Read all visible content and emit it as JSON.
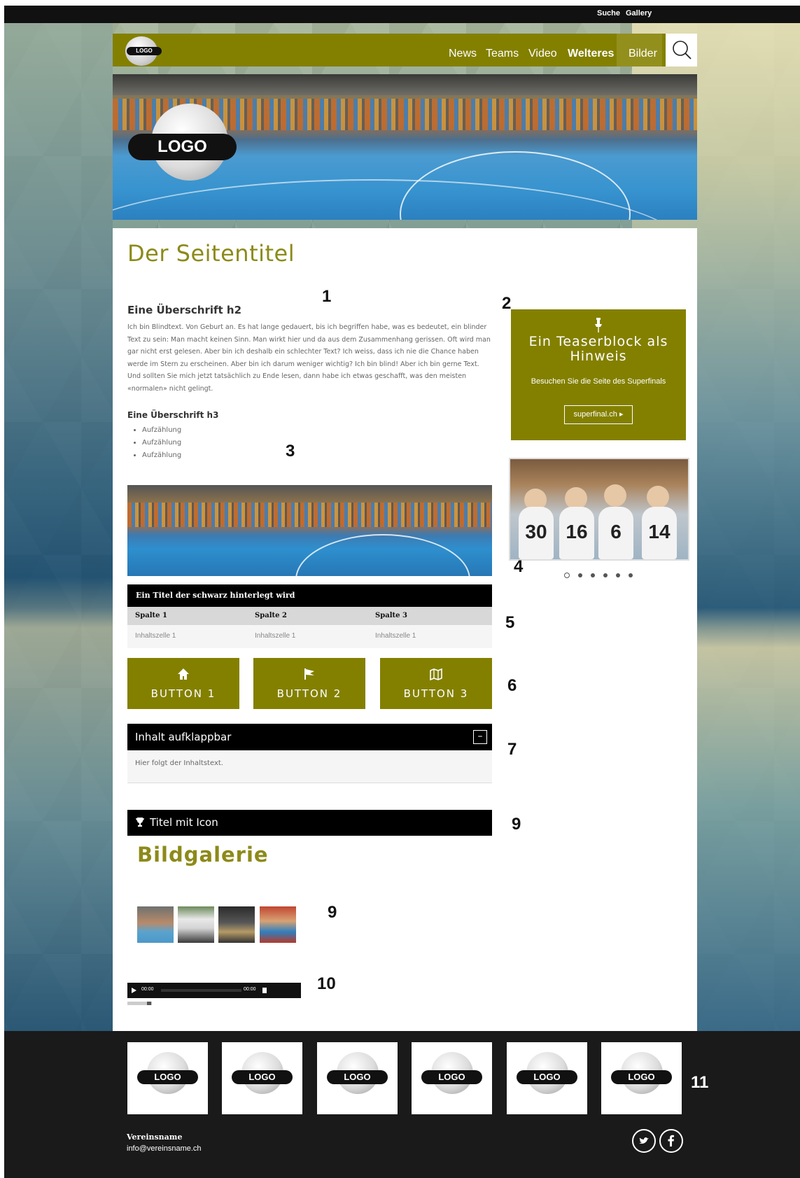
{
  "topbar": {
    "search": "Suche",
    "gallery": "Gallery"
  },
  "nav": {
    "logo_text": "LOGO",
    "items": [
      "News",
      "Teams",
      "Video",
      "Welteres",
      "Bilder"
    ]
  },
  "hero": {
    "logo_text": "LOGO"
  },
  "main": {
    "page_title": "Der Seitentitel",
    "h2": "Eine Überschrift h2",
    "body": "Ich bin Blindtext. Von Geburt an. Es hat lange gedauert, bis ich begriffen habe, was es bedeutet, ein blinder Text zu sein: Man macht keinen Sinn. Man wirkt hier und da aus dem Zusammenhang gerissen. Oft wird man gar nicht erst gelesen. Aber bin ich deshalb ein schlechter Text? Ich weiss, dass ich nie die Chance haben werde im Stern zu erscheinen. Aber bin ich darum weniger wichtig? Ich bin blind! Aber ich bin gerne Text. Und sollten Sie mich jetzt tatsächlich zu Ende lesen, dann habe ich etwas geschafft, was den meisten «normalen» nicht gelingt.",
    "h3": "Eine Überschrift h3",
    "bullets": [
      "Aufzählung",
      "Aufzählung",
      "Aufzählung"
    ]
  },
  "markers": [
    "1",
    "2",
    "3",
    "4",
    "5",
    "6",
    "7",
    "9",
    "9",
    "10",
    "11"
  ],
  "teaser": {
    "title": "Ein Teaserblock als Hinweis",
    "subtitle": "Besuchen Sie die Seite des Superfinals",
    "button": "superfinal.ch ▸"
  },
  "slider": {
    "jerseys": [
      "30",
      "16",
      "6",
      "14"
    ],
    "dots": 6,
    "active_dot": 0
  },
  "table": {
    "title": "Ein Titel der schwarz hinterlegt wird",
    "headers": [
      "Spalte 1",
      "Spalte 2",
      "Spalte 3"
    ],
    "rows": [
      [
        "Inhaltszelle 1",
        "Inhaltszelle 1",
        "Inhaltszelle 1"
      ]
    ]
  },
  "buttons": [
    {
      "label": "BUTTON 1",
      "icon": "home-icon"
    },
    {
      "label": "BUTTON 2",
      "icon": "flag-icon"
    },
    {
      "label": "BUTTON 3",
      "icon": "map-icon"
    }
  ],
  "accordion": {
    "title": "Inhalt aufklappbar",
    "toggle": "–",
    "content": "Hier folgt der Inhaltstext."
  },
  "icon_title": {
    "title": "Titel mit Icon",
    "icon": "trophy-icon"
  },
  "gallery": {
    "title": "Bildgalerie",
    "thumbs": 4
  },
  "audio": {
    "current": "00:00",
    "duration": "00:00"
  },
  "footer": {
    "sponsor_logo_text": "LOGO",
    "sponsors": 6,
    "club_name": "Vereinsname",
    "email": "info@vereinsname.ch",
    "social": [
      "twitter-icon",
      "facebook-icon"
    ]
  },
  "colors": {
    "accent": "#838000",
    "title": "#8d8a19",
    "dark": "#111111"
  }
}
